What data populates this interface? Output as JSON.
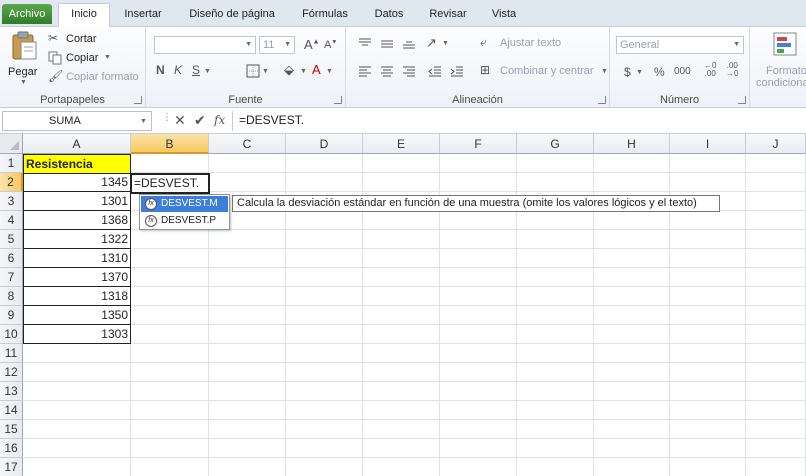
{
  "tabs": [
    {
      "label": "Archivo"
    },
    {
      "label": "Inicio"
    },
    {
      "label": "Insertar"
    },
    {
      "label": "Diseño de página"
    },
    {
      "label": "Fórmulas"
    },
    {
      "label": "Datos"
    },
    {
      "label": "Revisar"
    },
    {
      "label": "Vista"
    }
  ],
  "ribbon": {
    "clipboard": {
      "label": "Portapapeles",
      "paste": "Pegar",
      "cut": "Cortar",
      "copy": "Copiar",
      "format_painter": "Copiar formato"
    },
    "font": {
      "label": "Fuente",
      "font_size": "11",
      "bold": "N",
      "italic": "K",
      "underline": "S"
    },
    "alignment": {
      "label": "Alineación",
      "wrap_text": "Ajustar texto",
      "merge_center": "Combinar y centrar"
    },
    "number": {
      "label": "Número",
      "format": "General",
      "currency": "$",
      "percent": "%",
      "thousands": "000"
    },
    "styles": {
      "conditional_line1": "Formato",
      "conditional_line2": "condicional"
    }
  },
  "formula_bar": {
    "name_box": "SUMA",
    "fx": "fx",
    "formula": "=DESVEST."
  },
  "columns": [
    "A",
    "B",
    "C",
    "D",
    "E",
    "F",
    "G",
    "H",
    "I",
    "J"
  ],
  "rows": [
    "1",
    "2",
    "3",
    "4",
    "5",
    "6",
    "7",
    "8",
    "9",
    "10",
    "11",
    "12",
    "13",
    "14",
    "15",
    "16",
    "17"
  ],
  "cells": {
    "header": "Resistencia",
    "values": [
      "1345",
      "1301",
      "1368",
      "1322",
      "1310",
      "1370",
      "1318",
      "1350",
      "1303"
    ],
    "editing": "=DESVEST."
  },
  "autocomplete": {
    "items": [
      "DESVEST.M",
      "DESVEST.P"
    ],
    "tooltip": "Calcula la desviación estándar en función de una muestra (omite los valores lógicos y el texto)"
  },
  "colors": {
    "header_fill": "#ffff00",
    "selection_accent": "#f6c864",
    "highlight": "#3d7edb",
    "file_tab": "#2f7d2a"
  }
}
